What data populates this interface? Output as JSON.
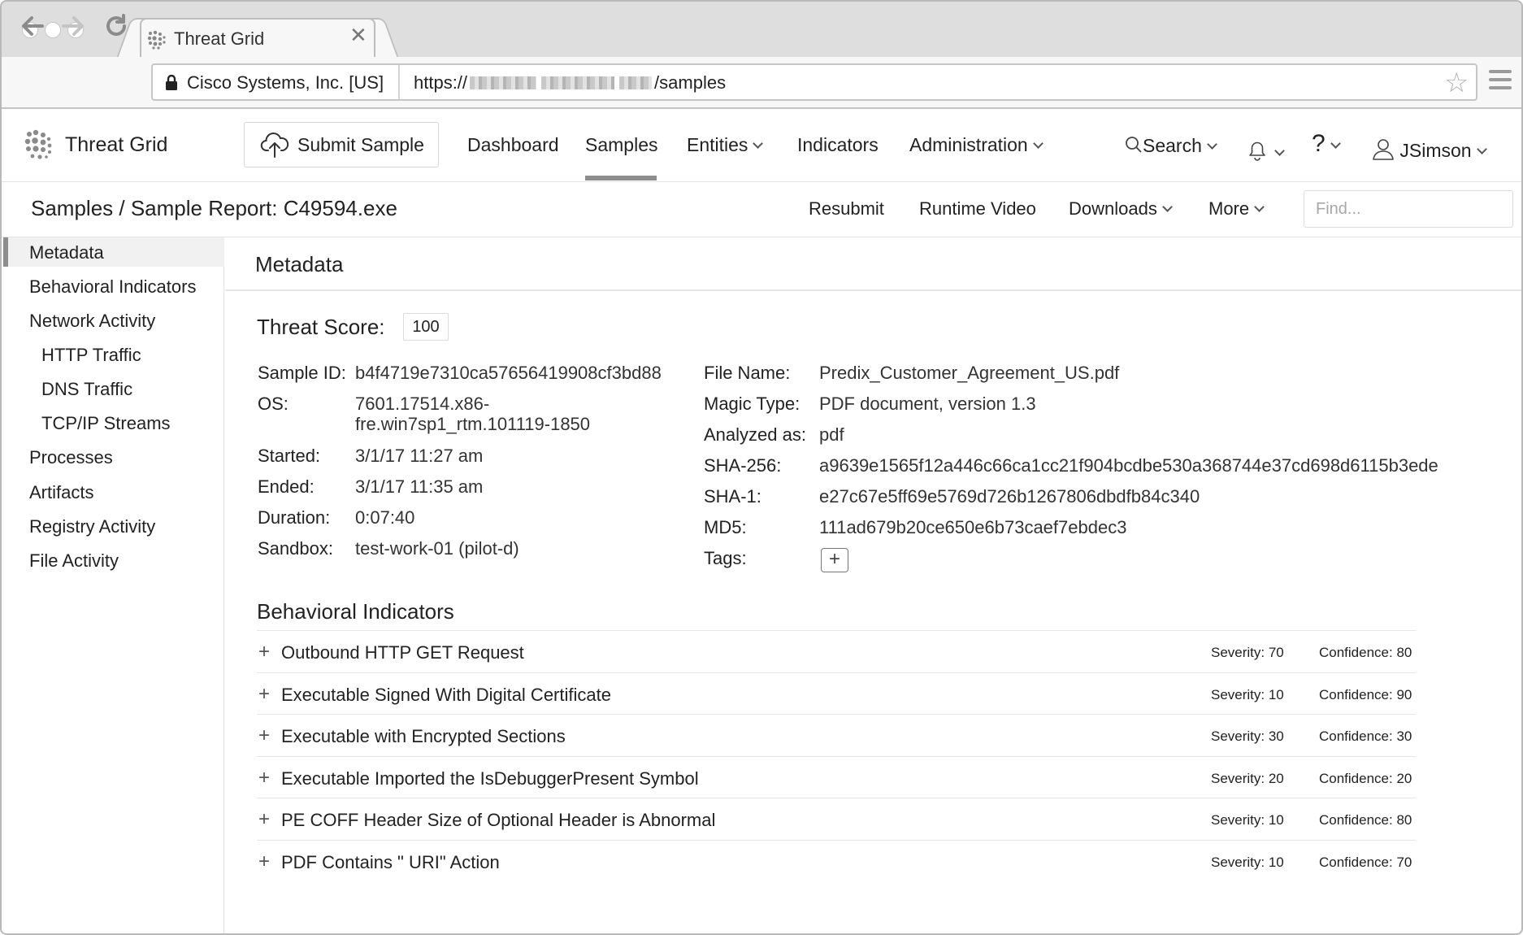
{
  "browser": {
    "tab_title": "Threat Grid",
    "tab_close": "✕",
    "secure_label": "Cisco Systems, Inc. [US]",
    "url_prefix": "https://",
    "url_suffix": "/samples"
  },
  "header": {
    "app_name": "Threat Grid",
    "submit_label": "Submit Sample",
    "nav": {
      "dashboard": "Dashboard",
      "samples": "Samples",
      "entities": "Entities",
      "indicators": "Indicators",
      "administration": "Administration",
      "search": "Search",
      "help": "?",
      "user": "JSimson"
    }
  },
  "subheader": {
    "breadcrumb": "Samples / Sample Report: C49594.exe",
    "actions": {
      "resubmit": "Resubmit",
      "runtime_video": "Runtime Video",
      "downloads": "Downloads",
      "more": "More"
    },
    "find_placeholder": "Find..."
  },
  "sidebar": {
    "items": [
      "Metadata",
      "Behavioral Indicators",
      "Network Activity",
      "HTTP Traffic",
      "DNS Traffic",
      "TCP/IP Streams",
      "Processes",
      "Artifacts",
      "Registry Activity",
      "File Activity"
    ]
  },
  "metadata": {
    "panel_title": "Metadata",
    "threat_score_label": "Threat Score:",
    "threat_score": "100",
    "left": {
      "sample_id_label": "Sample ID:",
      "sample_id": "b4f4719e7310ca57656419908cf3bd88",
      "os_label": "OS:",
      "os_line1": "7601.17514.x86-",
      "os_line2": "fre.win7sp1_rtm.101119-1850",
      "started_label": "Started:",
      "started": "3/1/17 11:27 am",
      "ended_label": "Ended:",
      "ended": "3/1/17 11:35 am",
      "duration_label": "Duration:",
      "duration": "0:07:40",
      "sandbox_label": "Sandbox:",
      "sandbox": "test-work-01 (pilot-d)"
    },
    "right": {
      "file_name_label": "File Name:",
      "file_name": "Predix_Customer_Agreement_US.pdf",
      "magic_type_label": "Magic Type:",
      "magic_type": "PDF document, version 1.3",
      "analyzed_as_label": "Analyzed as:",
      "analyzed_as": "pdf",
      "sha256_label": "SHA-256:",
      "sha256": "a9639e1565f12a446c66ca1cc21f904bcdbe530a368744e37cd698d6115b3ede",
      "sha1_label": "SHA-1:",
      "sha1": "e27c67e5ff69e5769d726b1267806dbdfb84c340",
      "md5_label": "MD5:",
      "md5": "111ad679b20ce650e6b73caef7ebdec3",
      "tags_label": "Tags:",
      "tags_add": "+"
    }
  },
  "behavioral_indicators": {
    "title": "Behavioral Indicators",
    "expand_symbol": "+",
    "rows": [
      {
        "name": "Outbound HTTP GET Request",
        "severity": "Severity: 70",
        "confidence": "Confidence: 80"
      },
      {
        "name": "Executable Signed With Digital Certificate",
        "severity": "Severity: 10",
        "confidence": "Confidence: 90"
      },
      {
        "name": "Executable with Encrypted Sections",
        "severity": "Severity: 30",
        "confidence": "Confidence: 30"
      },
      {
        "name": "Executable Imported the IsDebuggerPresent Symbol",
        "severity": "Severity: 20",
        "confidence": "Confidence: 20"
      },
      {
        "name": "PE COFF Header Size of Optional Header is Abnormal",
        "severity": "Severity: 10",
        "confidence": "Confidence: 80"
      },
      {
        "name": "PDF Contains \" URI\"  Action",
        "severity": "Severity: 10",
        "confidence": "Confidence: 70"
      }
    ]
  },
  "colors": {
    "chrome_bg": "#dedede",
    "active_indicator": "#8d8d8d",
    "text": "#222222",
    "border": "#e3e3e3"
  }
}
